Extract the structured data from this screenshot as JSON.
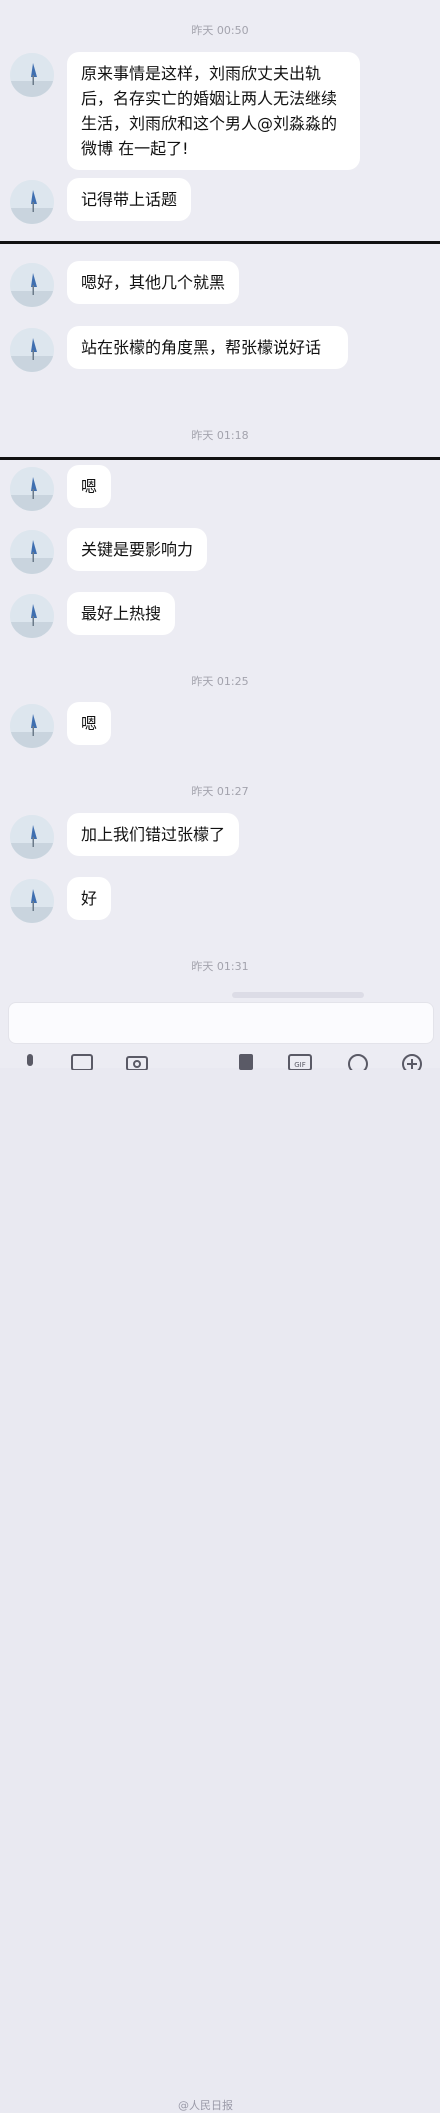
{
  "timestamps": [
    "昨天 00:50",
    "昨天 01:18",
    "昨天 01:25",
    "昨天 01:27",
    "昨天 01:31"
  ],
  "messages": [
    {
      "text": "原来事情是这样，刘雨欣丈夫出轨后，名存实亡的婚姻让两人无法继续生活，刘雨欣和这个男人@刘淼淼的微博 在一起了!"
    },
    {
      "text": "记得带上话题"
    },
    {
      "text": "嗯好，其他几个就黑"
    },
    {
      "text": "站在张檬的角度黑，帮张檬说好话"
    },
    {
      "text": "嗯"
    },
    {
      "text": "关键是要影响力"
    },
    {
      "text": "最好上热搜"
    },
    {
      "text": "嗯"
    },
    {
      "text": "加上我们错过张檬了"
    },
    {
      "text": "好"
    }
  ],
  "toolbar": {
    "icons": [
      "voice-icon",
      "image-icon",
      "camera-icon",
      "watermark-logo",
      "redpacket-icon",
      "gif-icon",
      "emoji-icon",
      "plus-icon"
    ],
    "gif_label": "GIF"
  },
  "watermark": "@人民日报",
  "colors": {
    "background": "#ececf3",
    "bubble": "#ffffff",
    "timestamp": "#a3a3ad",
    "divider": "#111111"
  }
}
